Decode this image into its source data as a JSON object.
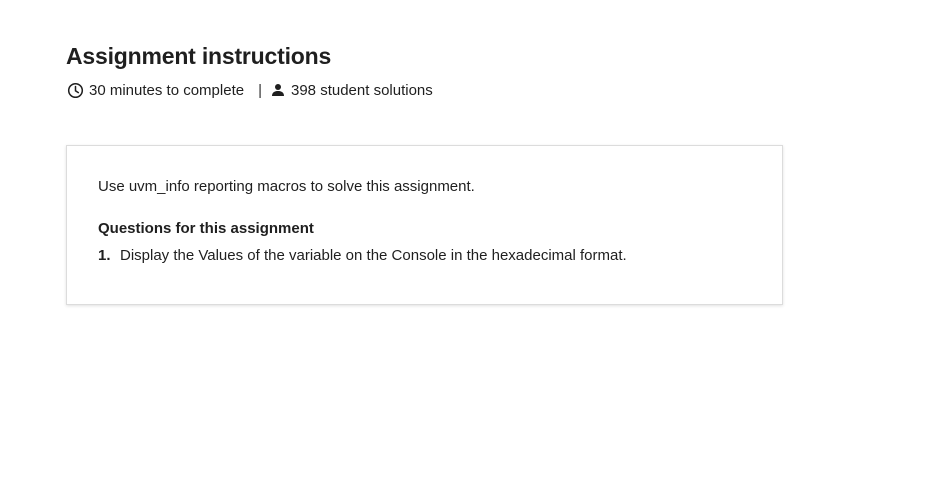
{
  "header": {
    "title": "Assignment instructions",
    "duration_icon": "clock-icon",
    "duration": "30 minutes to complete",
    "separator": "|",
    "solutions_icon": "person-icon",
    "solutions": "398 student solutions"
  },
  "card": {
    "intro": "Use uvm_info reporting macros to solve this assignment.",
    "questions_heading": "Questions for this assignment",
    "questions": [
      {
        "number": "1.",
        "text": "Display the Values of the variable on the Console in the hexadecimal format."
      }
    ]
  },
  "colors": {
    "text": "#1f1f1f",
    "card_border": "#dcdcdc",
    "background": "#ffffff"
  }
}
